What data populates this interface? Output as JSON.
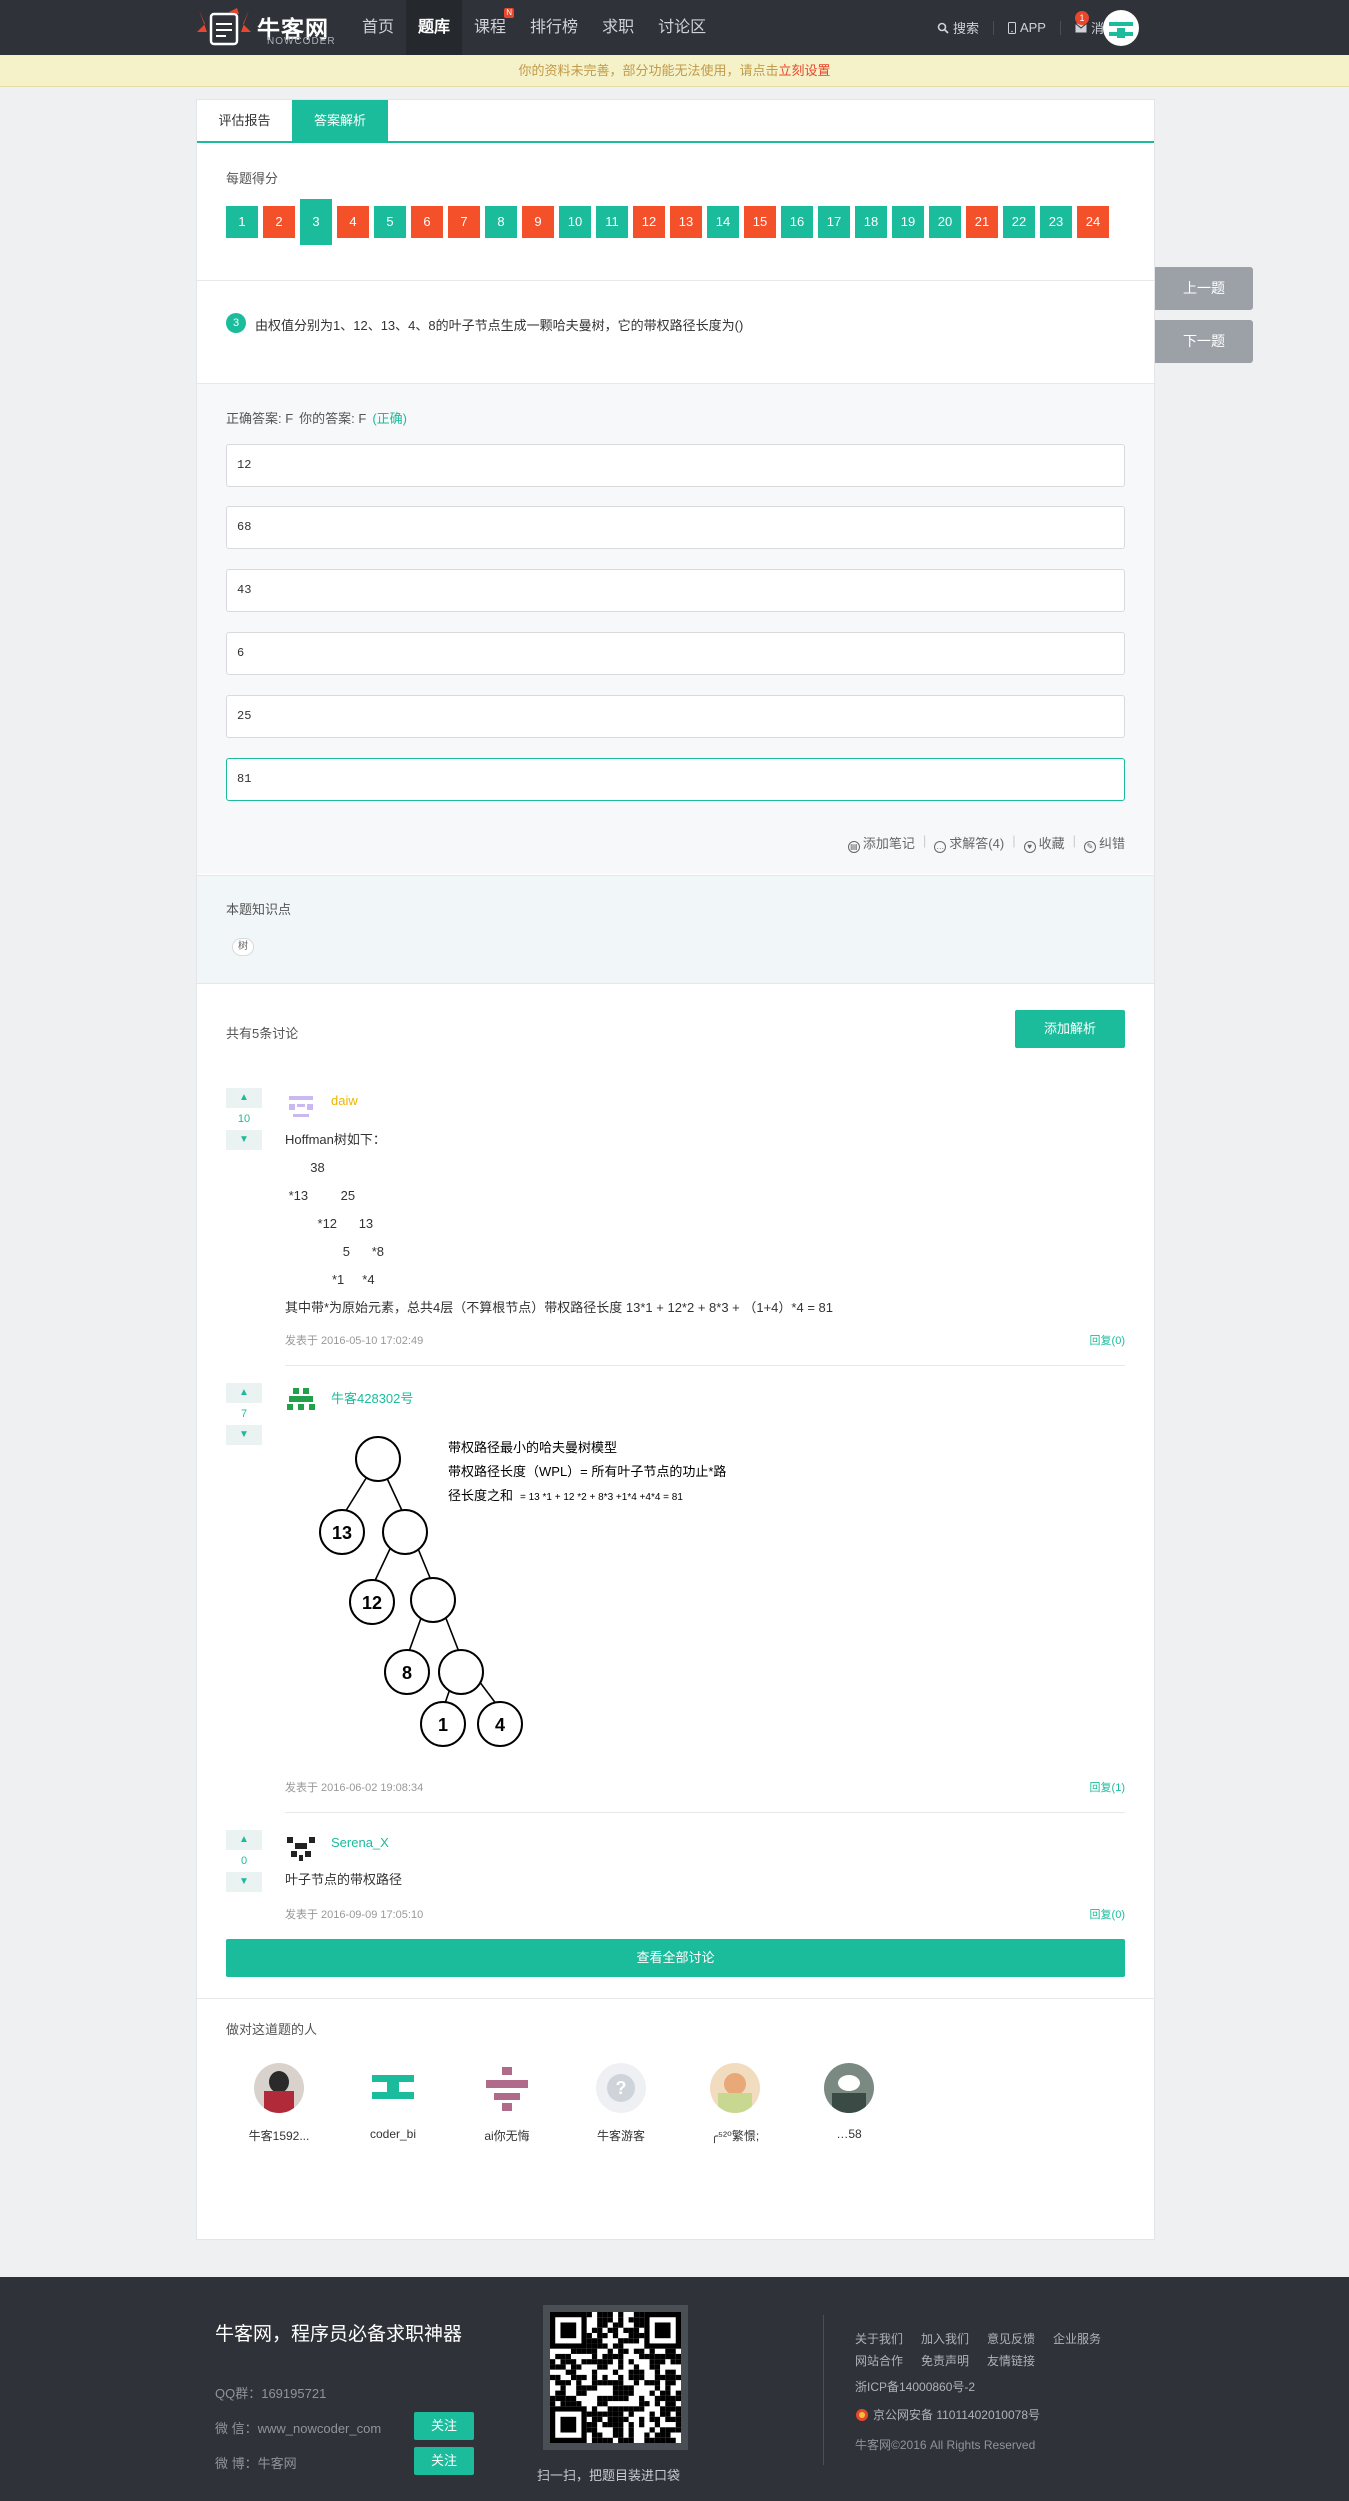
{
  "nav": {
    "logo_cn": "牛客网",
    "logo_en": "NOWCODER",
    "items": [
      {
        "label": "首页"
      },
      {
        "label": "题库"
      },
      {
        "label": "课程",
        "badge": "N"
      },
      {
        "label": "排行榜"
      },
      {
        "label": "求职"
      },
      {
        "label": "讨论区"
      }
    ],
    "search": "搜索",
    "app": "APP",
    "message": "消息",
    "message_count": "1"
  },
  "notice": {
    "text": "你的资料未完善，部分功能无法使用，请点击",
    "link": "立刻设置"
  },
  "tabs": [
    {
      "label": "评估报告"
    },
    {
      "label": "答案解析"
    }
  ],
  "score": {
    "title": "每题得分",
    "items": [
      {
        "n": "1",
        "status": "ok"
      },
      {
        "n": "2",
        "status": "bad"
      },
      {
        "n": "3",
        "status": "ok"
      },
      {
        "n": "4",
        "status": "bad"
      },
      {
        "n": "5",
        "status": "ok"
      },
      {
        "n": "6",
        "status": "bad"
      },
      {
        "n": "7",
        "status": "bad"
      },
      {
        "n": "8",
        "status": "ok"
      },
      {
        "n": "9",
        "status": "bad"
      },
      {
        "n": "10",
        "status": "ok"
      },
      {
        "n": "11",
        "status": "ok"
      },
      {
        "n": "12",
        "status": "bad"
      },
      {
        "n": "13",
        "status": "bad"
      },
      {
        "n": "14",
        "status": "ok"
      },
      {
        "n": "15",
        "status": "bad"
      },
      {
        "n": "16",
        "status": "ok"
      },
      {
        "n": "17",
        "status": "ok"
      },
      {
        "n": "18",
        "status": "ok"
      },
      {
        "n": "19",
        "status": "ok"
      },
      {
        "n": "20",
        "status": "ok"
      },
      {
        "n": "21",
        "status": "bad"
      },
      {
        "n": "22",
        "status": "ok"
      },
      {
        "n": "23",
        "status": "ok"
      },
      {
        "n": "24",
        "status": "bad"
      }
    ],
    "current": "3"
  },
  "question": {
    "number": "3",
    "text": "由权值分别为1、12、13、4、8的叶子节点生成一颗哈夫曼树，它的带权路径长度为()"
  },
  "answer": {
    "correct_label": "正确答案: F",
    "yours_label": "你的答案: F",
    "result": "(正确)",
    "options": [
      "12",
      "68",
      "43",
      "6",
      "25",
      "81"
    ],
    "selected_index": 5,
    "actions": [
      "添加笔记",
      "求解答(4)",
      "收藏",
      "纠错"
    ]
  },
  "knowledge": {
    "title": "本题知识点",
    "tag": "树"
  },
  "discussion": {
    "count_text": "共有5条讨论",
    "add_label": "添加解析",
    "view_all": "查看全部讨论",
    "comments": [
      {
        "votes": "10",
        "user": "daiw",
        "user_color": "#f0b400",
        "body_lines": [
          "Hoffman树如下：",
          "       38",
          " *13         25",
          "         *12      13",
          "                5      *8",
          "             *1     *4",
          "其中带*为原始元素，总共4层（不算根节点）带权路径长度 13*1 + 12*2 + 8*3 + （1+4）*4 = 81"
        ],
        "time": "发表于 2016-05-10 17:02:49",
        "reply": "回复(0)"
      },
      {
        "votes": "7",
        "user": "牛客428302号",
        "user_color": "#1bbc9b",
        "figure": {
          "lines": [
            "带权路径最小的哈夫曼树模型",
            "带权路径长度（WPL）= 所有叶子节点的功止*路",
            "径长度之和"
          ],
          "formula": "= 13 *1 + 12 *2 + 8*3 +1*4 +4*4 = 81",
          "nodes": [
            "13",
            "12",
            "8",
            "1",
            "4"
          ]
        },
        "time": "发表于 2016-06-02 19:08:34",
        "reply": "回复(1)"
      },
      {
        "votes": "0",
        "user": "Serena_X",
        "user_color": "#1bbc9b",
        "body_lines": [
          "叶子节点的带权路径"
        ],
        "time": "发表于 2016-09-09 17:05:10",
        "reply": "回复(0)"
      }
    ]
  },
  "people": {
    "title": "做对这道题的人",
    "list": [
      {
        "name": "牛客1592...",
        "color": "#a33"
      },
      {
        "name": "coder_bi",
        "color": "#1bbc9b"
      },
      {
        "name": "ai你无悔",
        "color": "#b06a8a"
      },
      {
        "name": "牛客游客",
        "color": "#cfd4da"
      },
      {
        "name": "╭⁵²⁰繁憬;",
        "color": "#e8c8a0"
      },
      {
        "name": "…58",
        "color": "#5a6a60"
      }
    ]
  },
  "side": {
    "prev": "上一题",
    "next": "下一题"
  },
  "footer": {
    "slogan": "牛客网，程序员必备求职神器",
    "qq": "QQ群：169195721",
    "wechat": "微 信：www_nowcoder_com",
    "weibo": "微 博：牛客网",
    "follow": "关注",
    "qr_caption": "扫一扫，把题目装进口袋",
    "links_row1": [
      "关于我们",
      "加入我们",
      "意见反馈",
      "企业服务"
    ],
    "links_row2": [
      "网站合作",
      "免责声明",
      "友情链接"
    ],
    "icp": "浙ICP备14000860号-2",
    "police": "京公网安备 11011402010078号",
    "copyright": "牛客网©2016 All Rights Reserved"
  }
}
